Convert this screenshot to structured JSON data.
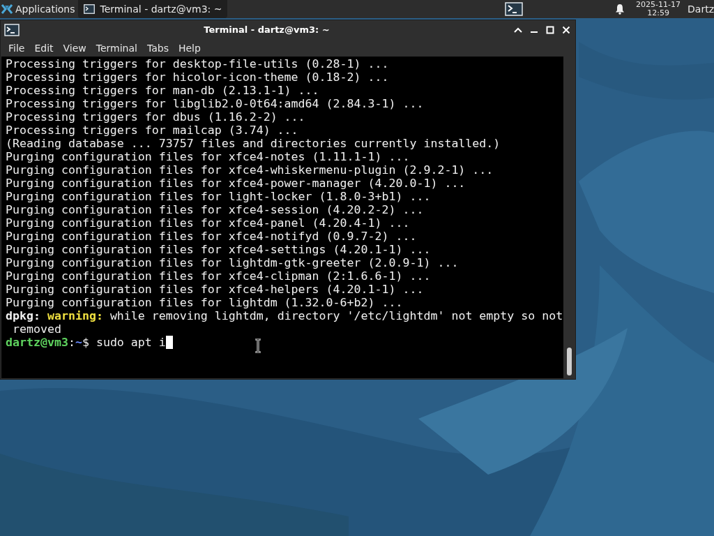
{
  "panel": {
    "applications_label": "Applications",
    "tasks": [
      {
        "title": "Terminal - dartz@vm3: ~",
        "selected": true
      }
    ],
    "clock": {
      "date": "2025-11-17",
      "time": "12:59"
    },
    "user": "Dartz"
  },
  "window": {
    "title": "Terminal - dartz@vm3: ~",
    "focused": true
  },
  "menu": [
    "File",
    "Edit",
    "View",
    "Terminal",
    "Tabs",
    "Help"
  ],
  "lines": [
    {
      "segments": [
        {
          "text": "Processing triggers for desktop-file-utils (0.28-1) ...",
          "kind": "plain"
        }
      ]
    },
    {
      "segments": [
        {
          "text": "Processing triggers for hicolor-icon-theme (0.18-2) ...",
          "kind": "plain"
        }
      ]
    },
    {
      "segments": [
        {
          "text": "Processing triggers for man-db (2.13.1-1) ...",
          "kind": "plain"
        }
      ]
    },
    {
      "segments": [
        {
          "text": "Processing triggers for libglib2.0-0t64:amd64 (2.84.3-1) ...",
          "kind": "plain"
        }
      ]
    },
    {
      "segments": [
        {
          "text": "Processing triggers for dbus (1.16.2-2) ...",
          "kind": "plain"
        }
      ]
    },
    {
      "segments": [
        {
          "text": "Processing triggers for mailcap (3.74) ...",
          "kind": "plain"
        }
      ]
    },
    {
      "segments": [
        {
          "text": "(Reading database ... 73757 files and directories currently installed.)",
          "kind": "plain"
        }
      ]
    },
    {
      "segments": [
        {
          "text": "Purging configuration files for xfce4-notes (1.11.1-1) ...",
          "kind": "plain"
        }
      ]
    },
    {
      "segments": [
        {
          "text": "Purging configuration files for xfce4-whiskermenu-plugin (2.9.2-1) ...",
          "kind": "plain"
        }
      ]
    },
    {
      "segments": [
        {
          "text": "Purging configuration files for xfce4-power-manager (4.20.0-1) ...",
          "kind": "plain"
        }
      ]
    },
    {
      "segments": [
        {
          "text": "Purging configuration files for light-locker (1.8.0-3+b1) ...",
          "kind": "plain"
        }
      ]
    },
    {
      "segments": [
        {
          "text": "Purging configuration files for xfce4-session (4.20.2-2) ...",
          "kind": "plain"
        }
      ]
    },
    {
      "segments": [
        {
          "text": "Purging configuration files for xfce4-panel (4.20.4-1) ...",
          "kind": "plain"
        }
      ]
    },
    {
      "segments": [
        {
          "text": "Purging configuration files for xfce4-notifyd (0.9.7-2) ...",
          "kind": "plain"
        }
      ]
    },
    {
      "segments": [
        {
          "text": "Purging configuration files for xfce4-settings (4.20.1-1) ...",
          "kind": "plain"
        }
      ]
    },
    {
      "segments": [
        {
          "text": "Purging configuration files for lightdm-gtk-greeter (2.0.9-1) ...",
          "kind": "plain"
        }
      ]
    },
    {
      "segments": [
        {
          "text": "Purging configuration files for xfce4-clipman (2:1.6.6-1) ...",
          "kind": "plain"
        }
      ]
    },
    {
      "segments": [
        {
          "text": "Purging configuration files for xfce4-helpers (4.20.1-1) ...",
          "kind": "plain"
        }
      ]
    },
    {
      "segments": [
        {
          "text": "Purging configuration files for lightdm (1.32.0-6+b2) ...",
          "kind": "plain"
        }
      ]
    },
    {
      "segments": [
        {
          "text": "dpkg: ",
          "kind": "bold"
        },
        {
          "text": "warning:",
          "kind": "warning"
        },
        {
          "text": " while removing lightdm, directory '/etc/lightdm' not empty so not",
          "kind": "plain"
        }
      ]
    },
    {
      "segments": [
        {
          "text": " removed",
          "kind": "plain"
        }
      ]
    },
    {
      "segments": [
        {
          "text": "dartz@vm3",
          "kind": "user"
        },
        {
          "text": ":",
          "kind": "plain"
        },
        {
          "text": "~",
          "kind": "path"
        },
        {
          "text": "$ sudo apt i",
          "kind": "plain"
        }
      ],
      "cursor": true
    }
  ]
}
